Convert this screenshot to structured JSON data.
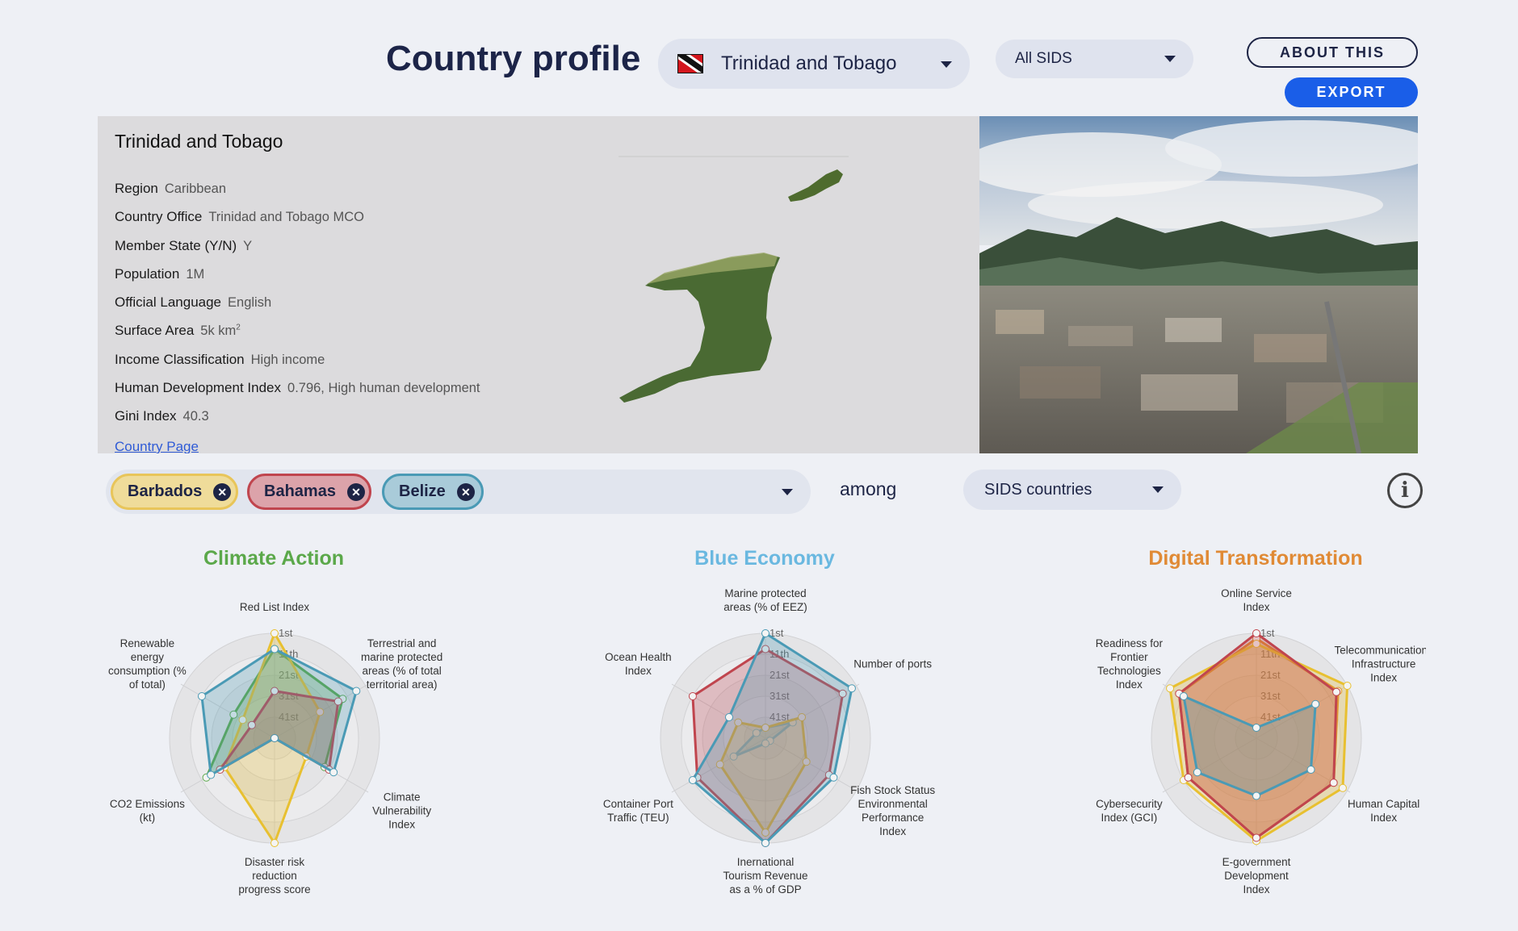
{
  "header": {
    "title": "Country profile",
    "country_select": "Trinidad and Tobago",
    "group_select": "All SIDS",
    "about_label": "ABOUT THIS",
    "export_label": "EXPORT"
  },
  "profile": {
    "name": "Trinidad and Tobago",
    "facts": [
      {
        "key": "Region",
        "value": "Caribbean"
      },
      {
        "key": "Country Office",
        "value": "Trinidad and Tobago MCO"
      },
      {
        "key": "Member State (Y/N)",
        "value": "Y"
      },
      {
        "key": "Population",
        "value": "1M"
      },
      {
        "key": "Official Language",
        "value": "English"
      },
      {
        "key": "Surface Area",
        "value": "5k km"
      },
      {
        "key": "Income Classification",
        "value": "High income"
      },
      {
        "key": "Human Development Index",
        "value": "0.796, High human development"
      },
      {
        "key": "Gini Index",
        "value": "40.3"
      }
    ],
    "surface_unit_sup": "2",
    "link_label": "Country Page"
  },
  "compare": {
    "chips": [
      {
        "label": "Barbados",
        "color": "#e8c55a",
        "bg": "#efdc9a"
      },
      {
        "label": "Bahamas",
        "color": "#c0454e",
        "bg": "#dca3aa"
      },
      {
        "label": "Belize",
        "color": "#4a9ab5",
        "bg": "#a9cbd9"
      }
    ],
    "among_label": "among",
    "group_select": "SIDS countries"
  },
  "rank_labels": [
    "1st",
    "11th",
    "21st",
    "31st",
    "41st"
  ],
  "charts": [
    {
      "title": "Climate Action",
      "color": "#5ba84a",
      "axes": [
        "Red List Index",
        "Terrestrial and marine protected areas (% of total territorial area)",
        "Climate Vulnerability Index",
        "Disaster risk reduction progress score",
        "CO2 Emissions (kt)",
        "Renewable energy consumption (% of total)"
      ],
      "axis_lines": [
        [
          "Red List Index"
        ],
        [
          "Terrestrial and",
          "marine protected",
          "areas (% of total",
          "territorial area)"
        ],
        [
          "Climate",
          "Vulnerability",
          "Index"
        ],
        [
          "Disaster risk",
          "reduction",
          "progress score"
        ],
        [
          "CO2 Emissions",
          "(kt)"
        ],
        [
          "Renewable",
          "energy",
          "consumption (%",
          "of total)"
        ]
      ],
      "series": [
        {
          "name": "Trinidad and Tobago",
          "color": "#5ba84a",
          "values": [
            0.85,
            0.75,
            0.55,
            0.0,
            0.75,
            0.45
          ]
        },
        {
          "name": "Barbados",
          "color": "#e8c030",
          "values": [
            1.0,
            0.5,
            0.35,
            1.0,
            0.55,
            0.35
          ]
        },
        {
          "name": "Bahamas",
          "color": "#c0454e",
          "values": [
            0.45,
            0.7,
            0.6,
            0.0,
            0.6,
            0.25
          ]
        },
        {
          "name": "Belize",
          "color": "#4a9ab5",
          "values": [
            0.85,
            0.9,
            0.65,
            0.0,
            0.7,
            0.8
          ]
        }
      ]
    },
    {
      "title": "Blue Economy",
      "color": "#6ab8e0",
      "axes": [
        "Marine protected areas (% of EEZ)",
        "Number of ports",
        "Fish Stock Status Environmental Performance Index",
        "Inernational Tourism Revenue as a % of GDP",
        "Container Port Traffic (TEU)",
        "Ocean Health Index"
      ],
      "axis_lines": [
        [
          "Marine protected",
          "areas (% of EEZ)"
        ],
        [
          "Number of ports"
        ],
        [
          "Fish Stock Status",
          "Environmental",
          "Performance",
          "Index"
        ],
        [
          "Inernational",
          "Tourism Revenue",
          "as a % of GDP"
        ],
        [
          "Container Port",
          "Traffic (TEU)"
        ],
        [
          "Ocean Health",
          "Index"
        ]
      ],
      "series": [
        {
          "name": "Trinidad and Tobago",
          "color": "#6ab8e0",
          "values": [
            0.1,
            0.3,
            0.05,
            0.05,
            0.35,
            0.1
          ]
        },
        {
          "name": "Barbados",
          "color": "#e8c030",
          "values": [
            0.1,
            0.4,
            0.45,
            0.9,
            0.5,
            0.3
          ]
        },
        {
          "name": "Bahamas",
          "color": "#c0454e",
          "values": [
            0.85,
            0.85,
            0.7,
            1.0,
            0.75,
            0.8
          ]
        },
        {
          "name": "Belize",
          "color": "#4a9ab5",
          "values": [
            1.0,
            0.95,
            0.75,
            1.0,
            0.8,
            0.4
          ]
        }
      ]
    },
    {
      "title": "Digital Transformation",
      "color": "#e08a35",
      "axes": [
        "Online Service Index",
        "Telecommunications Infrastructure Index",
        "Human Capital Index",
        "E-government Development Index",
        "Cybersecurity Index (GCI)",
        "Readiness for Frontier Technologies Index"
      ],
      "axis_lines": [
        [
          "Online Service",
          "Index"
        ],
        [
          "Telecommunications",
          "Infrastructure",
          "Index"
        ],
        [
          "Human Capital",
          "Index"
        ],
        [
          "E-government",
          "Development",
          "Index"
        ],
        [
          "Cybersecurity",
          "Index (GCI)"
        ],
        [
          "Readiness for",
          "Frontier",
          "Technologies",
          "Index"
        ]
      ],
      "series": [
        {
          "name": "Trinidad and Tobago",
          "color": "#e08a35",
          "values": [
            0.95,
            0.9,
            0.85,
            0.95,
            0.75,
            0.85
          ]
        },
        {
          "name": "Barbados",
          "color": "#e8c030",
          "values": [
            0.9,
            1.0,
            0.95,
            0.98,
            0.8,
            0.95
          ]
        },
        {
          "name": "Bahamas",
          "color": "#c0454e",
          "values": [
            1.0,
            0.88,
            0.85,
            0.95,
            0.75,
            0.85
          ]
        },
        {
          "name": "Belize",
          "color": "#4a9ab5",
          "values": [
            0.1,
            0.65,
            0.6,
            0.55,
            0.65,
            0.8
          ]
        }
      ]
    }
  ]
}
